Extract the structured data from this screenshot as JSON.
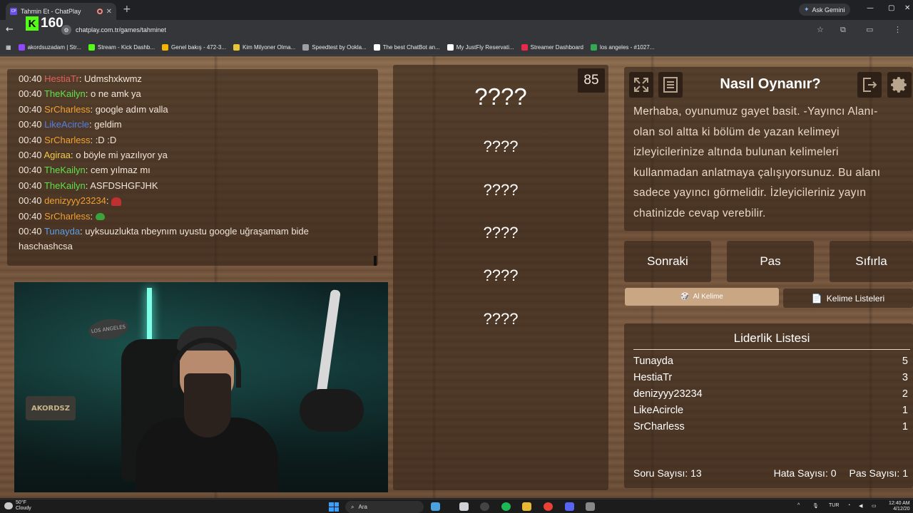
{
  "browser": {
    "tab_title": "Tahmin Et - ChatPlay",
    "tab_favicon": "CP",
    "new_tab_icon": "+",
    "ask_gemini": "Ask Gemini",
    "url": "chatplay.com.tr/games/tahminet",
    "bookmarks": [
      {
        "label": "akordsuzadam | Str...",
        "color": "#9146ff"
      },
      {
        "label": "Stream - Kick Dashb...",
        "color": "#53fc18"
      },
      {
        "label": "Genel bakış - 472-3...",
        "color": "#f4b400"
      },
      {
        "label": "Kim Milyoner Olma...",
        "color": "#e8c43a"
      },
      {
        "label": "Speedtest by Ookla...",
        "color": "#9aa0a6"
      },
      {
        "label": "The best ChatBot an...",
        "color": "#ffffff"
      },
      {
        "label": "My JustFly Reservati...",
        "color": "#ffffff"
      },
      {
        "label": "Streamer Dashboard",
        "color": "#e8294a"
      },
      {
        "label": "los angeles - #1027...",
        "color": "#34a853"
      }
    ]
  },
  "kick_overlay": {
    "logo": "K",
    "viewer_count": "160"
  },
  "chat": {
    "messages": [
      {
        "time": "00:40",
        "user": "HestiaTr",
        "color": "#e0605a",
        "text": ": Udmshxkwmz"
      },
      {
        "time": "00:40",
        "user": "TheKailyn",
        "color": "#5ee04a",
        "text": ": o ne amk ya"
      },
      {
        "time": "00:40",
        "user": "SrCharless",
        "color": "#f0a030",
        "text": ": google adım valla"
      },
      {
        "time": "00:40",
        "user": "LikeAcircle",
        "color": "#4f7fe6",
        "text": ": geldim"
      },
      {
        "time": "00:40",
        "user": "SrCharless",
        "color": "#f0a030",
        "text": ": :D :D"
      },
      {
        "time": "00:40",
        "user": "Agiraa",
        "color": "#f2c94c",
        "text": ": o böyle mi yazılıyor ya"
      },
      {
        "time": "00:40",
        "user": "TheKailyn",
        "color": "#5ee04a",
        "text": ": cem yılmaz mı"
      },
      {
        "time": "00:40",
        "user": "TheKailyn",
        "color": "#5ee04a",
        "text": ": ASFDSHGFJHK"
      },
      {
        "time": "00:40",
        "user": "denizyyy23234",
        "color": "#f0a030",
        "text": ": ",
        "emote": "heart"
      },
      {
        "time": "00:40",
        "user": "SrCharless",
        "color": "#f0a030",
        "text": ": ",
        "emote": "frog"
      },
      {
        "time": "00:40",
        "user": "Tunayda",
        "color": "#5aa0e6",
        "text": ": uyksuuzlukta nbeynım uyustu google uğraşamam bide"
      },
      {
        "time": "",
        "user": "",
        "color": "#ffffff",
        "text": "haschashcsa"
      }
    ]
  },
  "webcam": {
    "sign_top": "LOS ANGELES",
    "sign_bottom": "AKORDSZ"
  },
  "game": {
    "timer": "85",
    "main_word": "????",
    "hidden_words": [
      "????",
      "????",
      "????",
      "????",
      "????"
    ]
  },
  "howto": {
    "title": "Nasıl Oynanır?",
    "text": "Merhaba, oyunumuz gayet basit. -Yayıncı Alanı- olan sol altta ki bölüm de yazan kelimeyi izleyicilerinize altında bulunan kelimeleri kullanmadan anlatmaya çalışıyorsunuz. Bu alanı sadece yayıncı görmelidir. İzleyicileriniz yayın chatinizde cevap verebilir."
  },
  "controls": {
    "next": "Sonraki",
    "pass": "Pas",
    "reset": "Sıfırla",
    "get_word": "Al Kelime",
    "word_lists": "Kelime Listeleri"
  },
  "leaderboard": {
    "title": "Liderlik Listesi",
    "rows": [
      {
        "name": "Tunayda",
        "score": "5"
      },
      {
        "name": "HestiaTr",
        "score": "3"
      },
      {
        "name": "denizyyy23234",
        "score": "2"
      },
      {
        "name": "LikeAcircle",
        "score": "1"
      },
      {
        "name": "SrCharless",
        "score": "1"
      }
    ],
    "questions": "Soru Sayısı: 13",
    "errors": "Hata Sayısı: 0",
    "passes": "Pas Sayısı: 1"
  },
  "taskbar": {
    "temp": "50°F",
    "weather": "Cloudy",
    "search": "Ara",
    "lang": "TUR",
    "time": "12:40 AM",
    "date": "4/12/20"
  }
}
